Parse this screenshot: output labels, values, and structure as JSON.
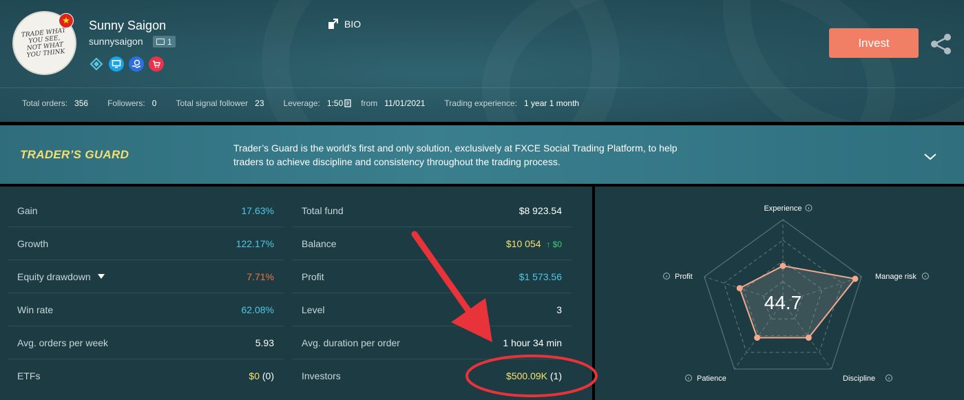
{
  "profile": {
    "name": "Sunny Saigon",
    "username": "sunnysaigon",
    "id_count": "1",
    "avatar_text": "TRADE WHAT YOU SEE, NOT WHAT YOU THINK",
    "flag_symbol": "★",
    "badge_icons": [
      "diamond-badge-icon",
      "monitor-badge-icon",
      "coin-hand-badge-icon",
      "cart-badge-icon"
    ],
    "badge_colors": [
      "#2a4f59",
      "#1aa3e8",
      "#2d6fe0",
      "#e8334a"
    ]
  },
  "bio_label": "BIO",
  "invest_label": "Invest",
  "stats": [
    {
      "label": "Total orders:",
      "value": "356"
    },
    {
      "label": "Followers:",
      "value": "0"
    },
    {
      "label": "Total signal follower",
      "value": "23"
    },
    {
      "label": "Leverage:",
      "value": "1:50"
    },
    {
      "label": "from",
      "value": "11/01/2021"
    },
    {
      "label": "Trading experience:",
      "value": "1 year 1 month"
    }
  ],
  "guard": {
    "title": "TRADER’S GUARD",
    "text": "Trader’s Guard is the world’s first and only solution, exclusively at FXCE Social Trading Platform, to help traders to achieve discipline and consistency throughout the trading process."
  },
  "left_rows": [
    {
      "label": "Gain",
      "value": "17.63%"
    },
    {
      "label": "Growth",
      "value": "122.17%"
    },
    {
      "label": "Equity drawdown",
      "value": "7.71%"
    },
    {
      "label": "Win rate",
      "value": "62.08%"
    },
    {
      "label": "Avg. orders per week",
      "value": "5.93"
    },
    {
      "label": "ETFs",
      "value": "$0",
      "extra": "(0)"
    }
  ],
  "right_rows": [
    {
      "label": "Total fund",
      "value": "$8 923.54"
    },
    {
      "label": "Balance",
      "value": "$10 054",
      "extra": "↑ $0"
    },
    {
      "label": "Profit",
      "value": "$1 573.56"
    },
    {
      "label": "Level",
      "value": "3"
    },
    {
      "label": "Avg. duration per order",
      "value": "1 hour 34 min"
    },
    {
      "label": "Investors",
      "value": "$500.09K",
      "extra": "(1)"
    }
  ],
  "radar": {
    "score": "44.7",
    "axes": [
      "Experience",
      "Manage risk",
      "Discipline",
      "Patience",
      "Profit"
    ],
    "values": [
      0.44,
      0.92,
      0.53,
      0.53,
      0.55
    ],
    "fill_color": "#f4a98f"
  },
  "colors": {
    "accent": "#f17f65",
    "highlight_circle": "#e8333a"
  }
}
